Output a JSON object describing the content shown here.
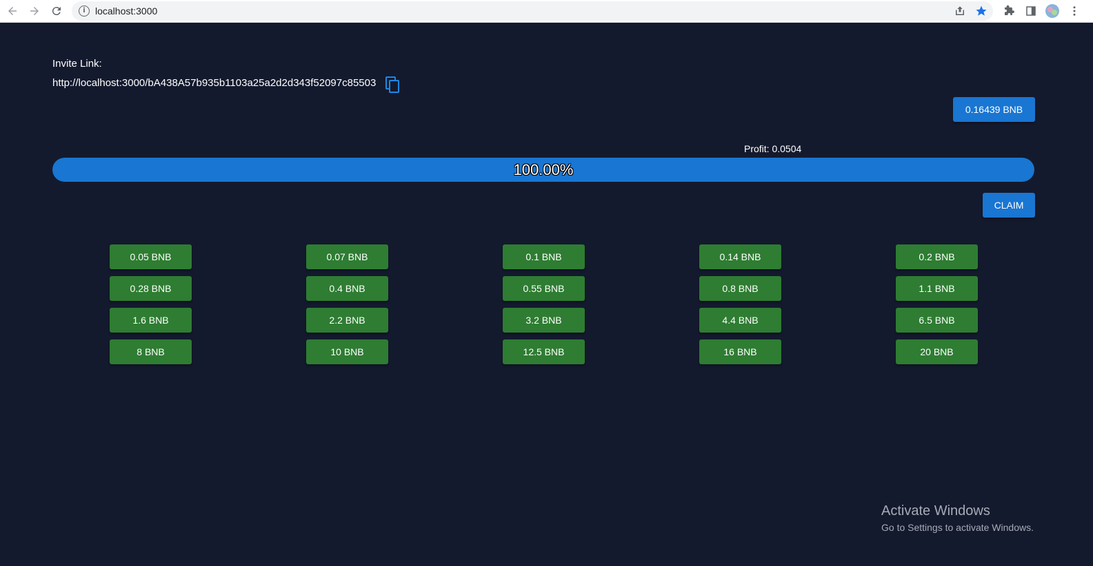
{
  "browser": {
    "url": "localhost:3000",
    "icons": [
      "back-arrow-icon",
      "forward-arrow-icon",
      "reload-icon",
      "site-info-icon",
      "share-icon",
      "bookmark-star-icon",
      "extensions-icon",
      "side-panel-icon",
      "profile-avatar",
      "more-menu-icon"
    ],
    "colors": {
      "star": "#1a73e8"
    }
  },
  "invite": {
    "label": "Invite Link:",
    "url": "http://localhost:3000/bA438A57b935b1103a25a2d2d343f52097c85503",
    "copy_icon": "copy-icon"
  },
  "balance": {
    "label": "0.16439 BNB"
  },
  "profit": {
    "text": "Profit: 0.0504"
  },
  "progress": {
    "percent": 100,
    "label": "100.00%"
  },
  "claim": {
    "label": "CLAIM"
  },
  "amounts": [
    "0.05 BNB",
    "0.07 BNB",
    "0.1 BNB",
    "0.14 BNB",
    "0.2 BNB",
    "0.28 BNB",
    "0.4 BNB",
    "0.55 BNB",
    "0.8 BNB",
    "1.1 BNB",
    "1.6 BNB",
    "2.2 BNB",
    "3.2 BNB",
    "4.4 BNB",
    "6.5 BNB",
    "8 BNB",
    "10 BNB",
    "12.5 BNB",
    "16 BNB",
    "20 BNB"
  ],
  "watermark": {
    "title": "Activate Windows",
    "subtitle": "Go to Settings to activate Windows."
  },
  "colors": {
    "background": "#141a2e",
    "primary": "#1976d2",
    "success": "#2e7d32"
  }
}
